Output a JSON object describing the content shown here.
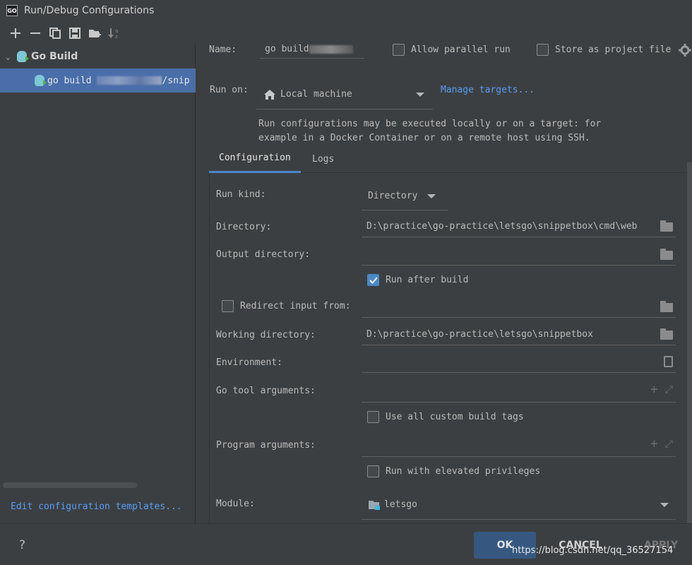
{
  "window": {
    "title": "Run/Debug Configurations",
    "logo": "GO"
  },
  "toolbar": {
    "icons": [
      "plus-icon",
      "minus-icon",
      "copy-icon",
      "save-icon",
      "new-folder-icon",
      "sort-icon"
    ]
  },
  "tree": {
    "group_label": "Go Build",
    "item_prefix": "go build ",
    "item_suffix": "/snip"
  },
  "edit_templates": "Edit configuration templates...",
  "config": {
    "name_label": "Name:",
    "name_value": "go build ",
    "allow_parallel": "Allow parallel run",
    "store_as_project": "Store as project file",
    "run_on_label": "Run on:",
    "run_on_value": "Local machine",
    "manage_targets": "Manage targets...",
    "run_on_hint_1": "Run configurations may be executed locally or on a target: for",
    "run_on_hint_2": "example in a Docker Container or on a remote host using SSH."
  },
  "tabs": [
    "Configuration",
    "Logs"
  ],
  "form": {
    "run_kind_label": "Run kind:",
    "run_kind_value": "Directory",
    "directory_label": "Directory:",
    "directory_value": "D:\\practice\\go-practice\\letsgo\\snippetbox\\cmd\\web",
    "output_dir_label": "Output directory:",
    "output_dir_value": "",
    "run_after_build": "Run after build",
    "run_after_build_checked": true,
    "redirect_input": "Redirect input from:",
    "redirect_checked": false,
    "working_dir_label": "Working directory:",
    "working_dir_value": "D:\\practice\\go-practice\\letsgo\\snippetbox",
    "environment_label": "Environment:",
    "go_tool_args_label": "Go tool arguments:",
    "custom_build_tags": "Use all custom build tags",
    "program_args_label": "Program arguments:",
    "elevated_privileges": "Run with elevated privileges",
    "module_label": "Module:",
    "module_value": "letsgo"
  },
  "buttons": {
    "help": "?",
    "ok": "OK",
    "cancel": "CANCEL",
    "apply": "APPLY"
  },
  "watermark": "https://blog.csdn.net/qq_36527154"
}
